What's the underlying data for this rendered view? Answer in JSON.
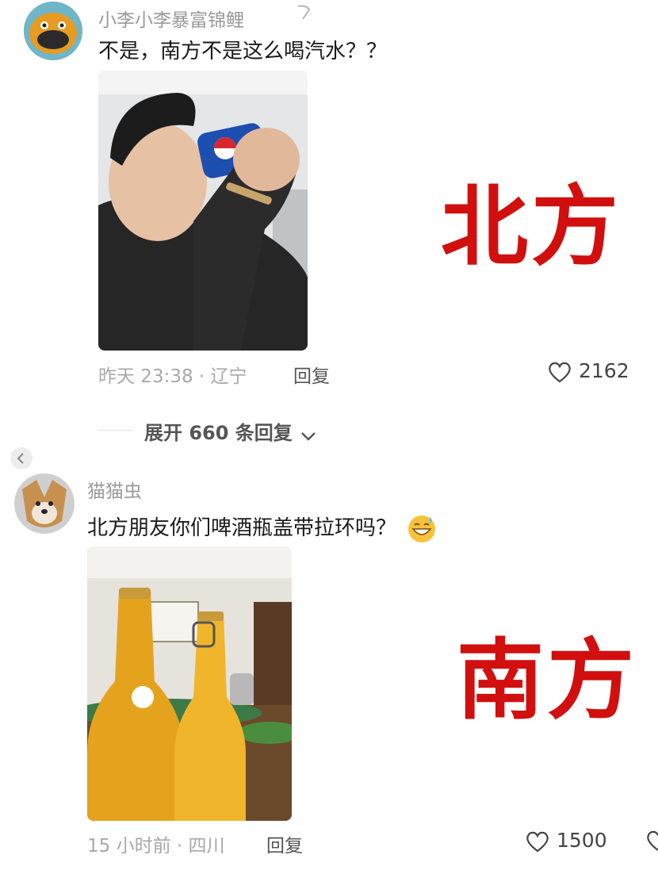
{
  "comments": [
    {
      "username": "小李小李暴富锦鲤",
      "text": "不是，南方不是这么喝汽水？？",
      "meta": "昨天 23:38 · 辽宁",
      "reply_label": "回复",
      "likes": "2162",
      "overlay_label": "北方",
      "expand_label": "展开 660 条回复"
    },
    {
      "username": "猫猫虫",
      "text": "北方朋友你们啤酒瓶盖带拉环吗？",
      "meta": "15 小时前 · 四川",
      "reply_label": "回复",
      "likes": "1500",
      "overlay_label": "南方"
    }
  ],
  "colors": {
    "overlay_red": "#d10f0f",
    "muted_text": "#a8a8a8"
  }
}
